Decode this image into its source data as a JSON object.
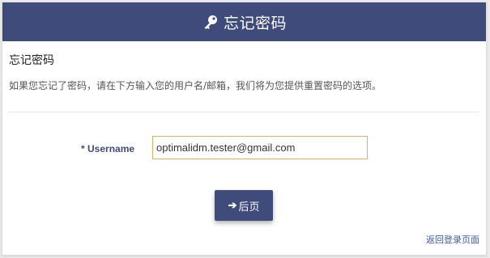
{
  "header": {
    "title": "忘记密码",
    "icon": "key-icon"
  },
  "form": {
    "section_title": "忘记密码",
    "description": "如果您忘记了密码，请在下方输入您的用户名/邮箱，我们将为您提供重置密码的选项。",
    "username_label": "* Username",
    "username_value": "optimalidm.tester@gmail.com",
    "next_button_label": "后页",
    "next_button_icon": "arrow-right-icon"
  },
  "footer": {
    "back_link": "返回登录页面"
  },
  "colors": {
    "header_bg": "#3f4b7b",
    "input_border": "#d9b36a",
    "link": "#3f5b9c"
  }
}
